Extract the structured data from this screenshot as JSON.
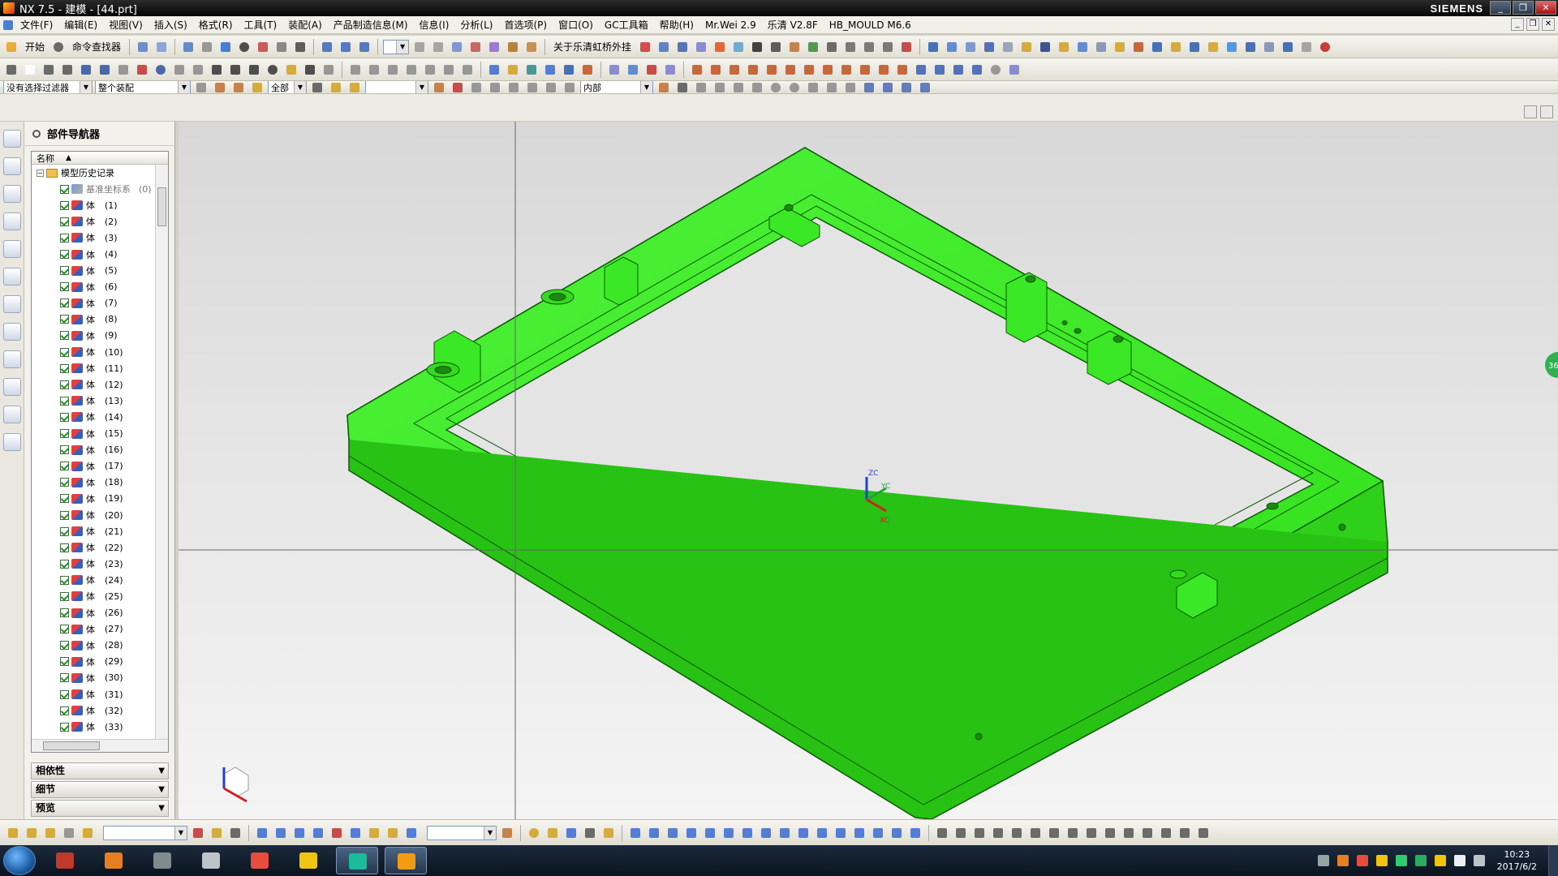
{
  "title": {
    "text": "NX 7.5 - 建模 - [44.prt]",
    "brand": "SIEMENS"
  },
  "window_buttons": {
    "min": "_",
    "max": "❐",
    "close": "✕"
  },
  "menu": [
    "文件(F)",
    "编辑(E)",
    "视图(V)",
    "插入(S)",
    "格式(R)",
    "工具(T)",
    "装配(A)",
    "产品制造信息(M)",
    "信息(I)",
    "分析(L)",
    "首选项(P)",
    "窗口(O)",
    "GC工具箱",
    "帮助(H)",
    "Mr.Wei 2.9",
    "乐清 V2.8F",
    "HB_MOULD M6.6"
  ],
  "toolbar1": {
    "start_label": "开始",
    "command_finder": "命令查找器",
    "plugin_label": "关于乐清虹桥外挂"
  },
  "toolbar3": {
    "filter_value": "没有选择过滤器",
    "assembly_value": "整个装配",
    "select_all": "全部",
    "scope_value": "内部"
  },
  "navigator": {
    "title": "部件导航器",
    "column_name": "名称",
    "root_label": "模型历史记录",
    "datum_label": "基准坐标系",
    "datum_index": "(0)",
    "body_label": "体",
    "bodies": [
      "(1)",
      "(2)",
      "(3)",
      "(4)",
      "(5)",
      "(6)",
      "(7)",
      "(8)",
      "(9)",
      "(10)",
      "(11)",
      "(12)",
      "(13)",
      "(14)",
      "(15)",
      "(16)",
      "(17)",
      "(18)",
      "(19)",
      "(20)",
      "(21)",
      "(22)",
      "(23)",
      "(24)",
      "(25)",
      "(26)",
      "(27)",
      "(28)",
      "(29)",
      "(30)",
      "(31)",
      "(32)",
      "(33)"
    ],
    "panels": [
      "相依性",
      "细节",
      "预览"
    ]
  },
  "viewport": {
    "model_color": "#3ef028",
    "axis_labels": {
      "zc": "ZC",
      "yc": "YC",
      "xc": "XC"
    },
    "side_badge": "36"
  },
  "taskbar": {
    "time": "10:23",
    "date": "2017/6/2"
  }
}
